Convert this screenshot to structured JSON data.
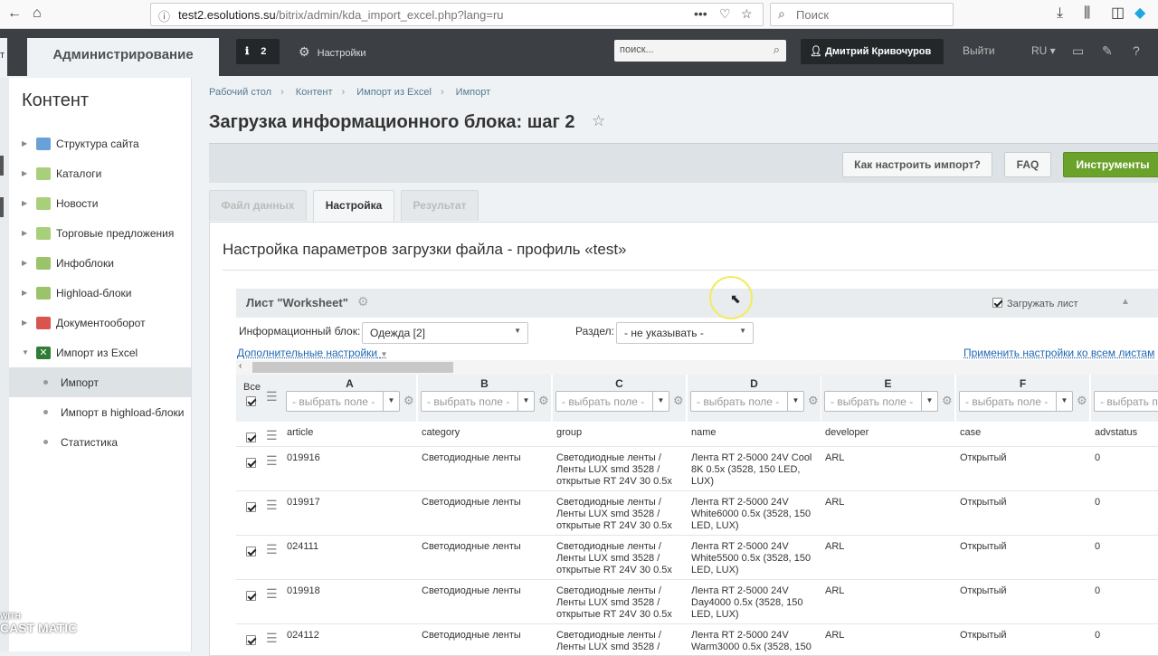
{
  "browser": {
    "url_prefix": "test2.",
    "url_domain": "esolutions.su",
    "url_path": "/bitrix/admin/kda_import_excel.php?lang=ru",
    "search_placeholder": "Поиск"
  },
  "admin_bar": {
    "left_fragment": "т",
    "admin_tab": "Администрирование",
    "notifications_count": "2",
    "settings_label": "Настройки",
    "search_placeholder": "поиск...",
    "user_name": "Дмитрий Кривочуров",
    "logout": "Выйти",
    "language": "RU"
  },
  "sidebar": {
    "title": "Контент",
    "items": [
      {
        "label": "Структура сайта",
        "icon": "site-structure-icon",
        "color": "#6aa0d8"
      },
      {
        "label": "Каталоги",
        "icon": "catalog-icon",
        "color": "#9bc36b"
      },
      {
        "label": "Новости",
        "icon": "news-icon",
        "color": "#9bc36b"
      },
      {
        "label": "Торговые предложения",
        "icon": "offers-icon",
        "color": "#9bc36b"
      },
      {
        "label": "Инфоблоки",
        "icon": "infoblocks-icon",
        "color": "#8fb86a"
      },
      {
        "label": "Highload-блоки",
        "icon": "highload-icon",
        "color": "#8fb86a"
      },
      {
        "label": "Документооборот",
        "icon": "documents-icon",
        "color": "#d9534f"
      },
      {
        "label": "Импорт из Excel",
        "icon": "excel-icon",
        "color": "#2e7d32"
      }
    ],
    "subitems": [
      {
        "label": "Импорт"
      },
      {
        "label": "Импорт в highload-блоки"
      },
      {
        "label": "Статистика"
      }
    ]
  },
  "breadcrumb": [
    "Рабочий стол",
    "Контент",
    "Импорт из Excel",
    "Импорт"
  ],
  "page_title": "Загрузка информационного блока: шаг 2",
  "toolbar": {
    "how_to": "Как настроить импорт?",
    "faq": "FAQ",
    "tools": "Инструменты"
  },
  "tabs": [
    "Файл данных",
    "Настройка",
    "Результат"
  ],
  "content": {
    "title": "Настройка параметров загрузки файла - профиль «test»",
    "sheet_name": "Лист \"Worksheet\"",
    "load_sheet": "Загружать лист",
    "iblock_label": "Информационный блок:",
    "iblock_value": "Одежда [2]",
    "section_label": "Раздел:",
    "section_value": "- не указывать -",
    "extra_settings": "Дополнительные настройки",
    "apply_all": "Применить настройки ко всем листам",
    "all_label": "Все",
    "field_placeholder": "- выбрать поле -"
  },
  "grid": {
    "columns": [
      "A",
      "B",
      "C",
      "D",
      "E",
      "F",
      ""
    ],
    "header_row": [
      "article",
      "category",
      "group",
      "name",
      "developer",
      "case",
      "advstatus"
    ],
    "rows": [
      [
        "019916",
        "Светодиодные ленты",
        "Светодиодные ленты /\nЛенты LUX smd 3528 /\nоткрытые RT 24V 30 0.5x",
        "Лента RT 2-5000 24V Cool\n8K 0.5x (3528, 150 LED,\nLUX)",
        "ARL",
        "Открытый",
        "0"
      ],
      [
        "019917",
        "Светодиодные ленты",
        "Светодиодные ленты /\nЛенты LUX smd 3528 /\nоткрытые RT 24V 30 0.5x",
        "Лента RT 2-5000 24V\nWhite6000 0.5x (3528, 150\nLED, LUX)",
        "ARL",
        "Открытый",
        "0"
      ],
      [
        "024111",
        "Светодиодные ленты",
        "Светодиодные ленты /\nЛенты LUX smd 3528 /\nоткрытые RT 24V 30 0.5x",
        "Лента RT 2-5000 24V\nWhite5500 0.5x (3528, 150\nLED, LUX)",
        "ARL",
        "Открытый",
        "0"
      ],
      [
        "019918",
        "Светодиодные ленты",
        "Светодиодные ленты /\nЛенты LUX smd 3528 /\nоткрытые RT 24V 30 0.5x",
        "Лента RT 2-5000 24V\nDay4000 0.5x (3528, 150\nLED, LUX)",
        "ARL",
        "Открытый",
        "0"
      ],
      [
        "024112",
        "Светодиодные ленты",
        "Светодиодные ленты /\nЛенты LUX smd 3528 /",
        "Лента RT 2-5000 24V\nWarm3000 0.5x (3528, 150",
        "ARL",
        "Открытый",
        "0"
      ]
    ]
  },
  "watermark": {
    "top": "WITH",
    "brand": "CAST  MATIC"
  },
  "colors": {
    "accent_green": "#6ba22b",
    "admin_bar": "#3c4044",
    "link": "#2067b0"
  }
}
